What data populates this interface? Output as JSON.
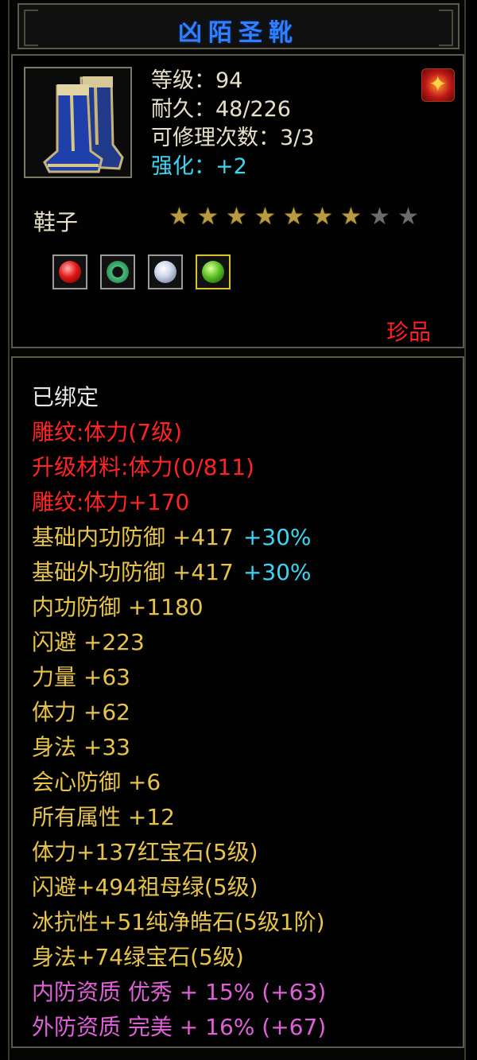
{
  "title": "凶陌圣靴",
  "item": {
    "level": "等级：94",
    "durability": "耐久：48/226",
    "repairs": "可修理次数：3/3",
    "enhance": "强化：+2",
    "type": "鞋子",
    "stars_filled": 7,
    "stars_total": 9,
    "rarity": "珍品"
  },
  "icons": {
    "item_icon": "blue-boots-icon",
    "emblem": "phoenix-emblem-icon",
    "gems": [
      "red-gem-icon",
      "jade-ring-icon",
      "diamond-icon",
      "green-gem-icon"
    ]
  },
  "colors": {
    "title": "#2f7fff",
    "red": "#ff2323",
    "yellow": "#e8c34a",
    "cyan": "#3ad6f5",
    "pink": "#e060d8",
    "white": "#e6e6e6"
  },
  "attributes": {
    "bound": "已绑定",
    "engrave": "雕纹:体力(7级)",
    "upgrade_material": "升级材料:体力(0/811)",
    "engrave_bonus": "雕纹:体力+170",
    "base_inner_def": "基础内功防御 +417",
    "base_inner_def_pct": "+30%",
    "base_outer_def": "基础外功防御 +417",
    "base_outer_def_pct": "+30%",
    "inner_def": "内功防御 +1180",
    "dodge": "闪避 +223",
    "strength": "力量 +63",
    "stamina": "体力 +62",
    "agility": "身法 +33",
    "crit_def": "会心防御 +6",
    "all_attr": "所有属性 +12",
    "gem1": "体力+137红宝石(5级)",
    "gem2": "闪避+494祖母绿(5级)",
    "gem3": "冰抗性+51纯净皓石(5级1阶)",
    "gem4": "身法+74绿宝石(5级)",
    "inner_quality": "内防资质 优秀 + 15% (+63)",
    "outer_quality": "外防资质 完美 + 16% (+67)"
  }
}
